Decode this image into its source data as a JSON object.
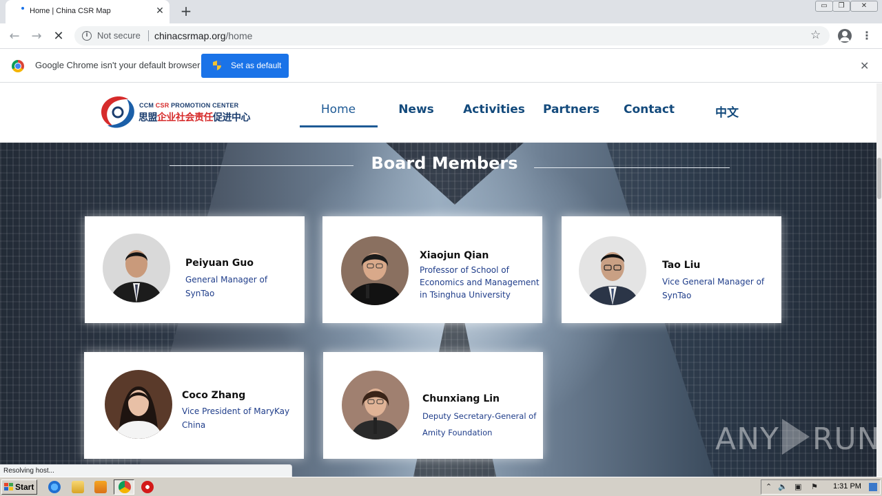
{
  "browser": {
    "tab_title": "Home | China CSR Map",
    "tab_close": "✕",
    "new_tab": "+",
    "window_buttons": {
      "minimize": "▭",
      "maximize": "❐",
      "close": "✕"
    },
    "security_label": "Not secure",
    "url_host": "chinacsrmap.org",
    "url_path": "/home",
    "status_text": "Resolving host..."
  },
  "infobar": {
    "message": "Google Chrome isn't your default browser",
    "button_label": "Set as default",
    "close": "✕"
  },
  "site": {
    "logo_en_prefix": "CCM ",
    "logo_en_csr": "CSR",
    "logo_en_suffix": " PROMOTION CENTER",
    "logo_cn_prefix": "思盟",
    "logo_cn_red": "企业社会责任",
    "logo_cn_suffix": "促进中心",
    "nav": [
      {
        "label": "Home",
        "active": true
      },
      {
        "label": "News",
        "active": false
      },
      {
        "label": "Activities",
        "active": false
      },
      {
        "label": "Partners",
        "active": false
      },
      {
        "label": "Contact",
        "active": false
      },
      {
        "label": "中文",
        "active": false
      }
    ],
    "section_title": "Board Members",
    "members": [
      {
        "name": "Peiyuan Guo",
        "title_lines": [
          "General Manager of",
          "SynTao"
        ]
      },
      {
        "name": "Xiaojun Qian",
        "title_lines": [
          "Professor of School of",
          "Economics and Management",
          "in Tsinghua University"
        ]
      },
      {
        "name": "Tao Liu",
        "title_lines": [
          "Vice General Manager of",
          "SynTao"
        ]
      },
      {
        "name": "Coco Zhang",
        "title_lines": [
          "Vice President of MaryKay",
          "China"
        ]
      },
      {
        "name": "Chunxiang Lin",
        "title_lines": [
          "Deputy Secretary-General of",
          "Amity Foundation"
        ]
      }
    ],
    "watermark_left": "ANY",
    "watermark_right": "RUN"
  },
  "taskbar": {
    "start_label": "Start",
    "clock": "1:31 PM"
  },
  "colors": {
    "accent_blue": "#1a73e8",
    "nav_blue": "#134a7c",
    "member_title_blue": "#1f3d8a",
    "logo_red": "#d62b2b"
  },
  "icons": [
    "info-icon",
    "star-icon",
    "profile-icon",
    "menu-icon",
    "chrome-logo-icon",
    "shield-icon",
    "windows-flag-icon",
    "ie-icon",
    "folder-icon",
    "media-player-icon",
    "chrome-icon",
    "opera-icon"
  ]
}
